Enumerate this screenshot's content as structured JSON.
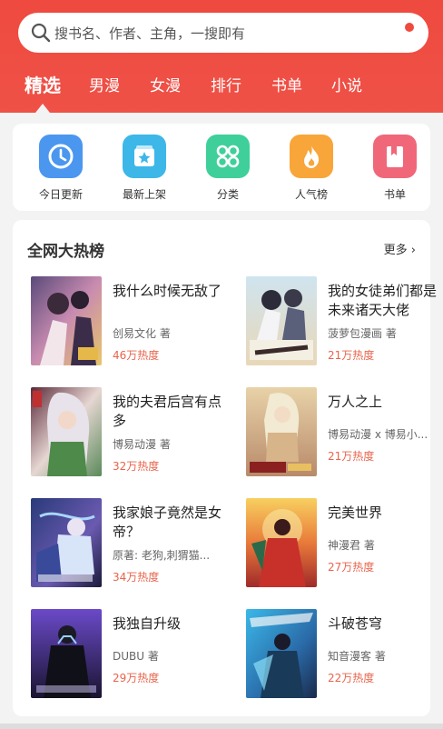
{
  "search": {
    "placeholder": "搜书名、作者、主角，一搜即有"
  },
  "tabs": [
    {
      "label": "精选",
      "active": true
    },
    {
      "label": "男漫"
    },
    {
      "label": "女漫"
    },
    {
      "label": "排行"
    },
    {
      "label": "书单"
    },
    {
      "label": "小说"
    }
  ],
  "quick": [
    {
      "label": "今日更新",
      "icon": "clock-icon",
      "color": "#4b97ef"
    },
    {
      "label": "最新上架",
      "icon": "star-box-icon",
      "color": "#3cb7e8"
    },
    {
      "label": "分类",
      "icon": "grid-icon",
      "color": "#3fcf9a"
    },
    {
      "label": "人气榜",
      "icon": "flame-icon",
      "color": "#f8a53a"
    },
    {
      "label": "书单",
      "icon": "bookmark-book-icon",
      "color": "#f0677a"
    }
  ],
  "ranking": {
    "title": "全网大热榜",
    "more": "更多",
    "books": [
      {
        "title": "我什么时候无敌了",
        "author": "创易文化 著",
        "heat": "46万热度"
      },
      {
        "title": "我的女徒弟们都是未来诸天大佬",
        "author": "菠萝包漫画 著",
        "heat": "21万热度"
      },
      {
        "title": "我的夫君后宫有点多",
        "author": "博易动漫 著",
        "heat": "32万热度"
      },
      {
        "title": "万人之上",
        "author": "博易动漫 x 博易小...",
        "heat": "21万热度"
      },
      {
        "title": "我家娘子竟然是女帝？",
        "author": "原著: 老狗,刺猬猫...",
        "heat": "34万热度"
      },
      {
        "title": "完美世界",
        "author": "神漫君 著",
        "heat": "27万热度"
      },
      {
        "title": "我独自升级",
        "author": "DUBU 著",
        "heat": "29万热度"
      },
      {
        "title": "斗破苍穹",
        "author": "知音漫客 著",
        "heat": "22万热度"
      }
    ]
  },
  "colors": {
    "brand": "#ef4a3f",
    "heat": "#e8644c"
  }
}
